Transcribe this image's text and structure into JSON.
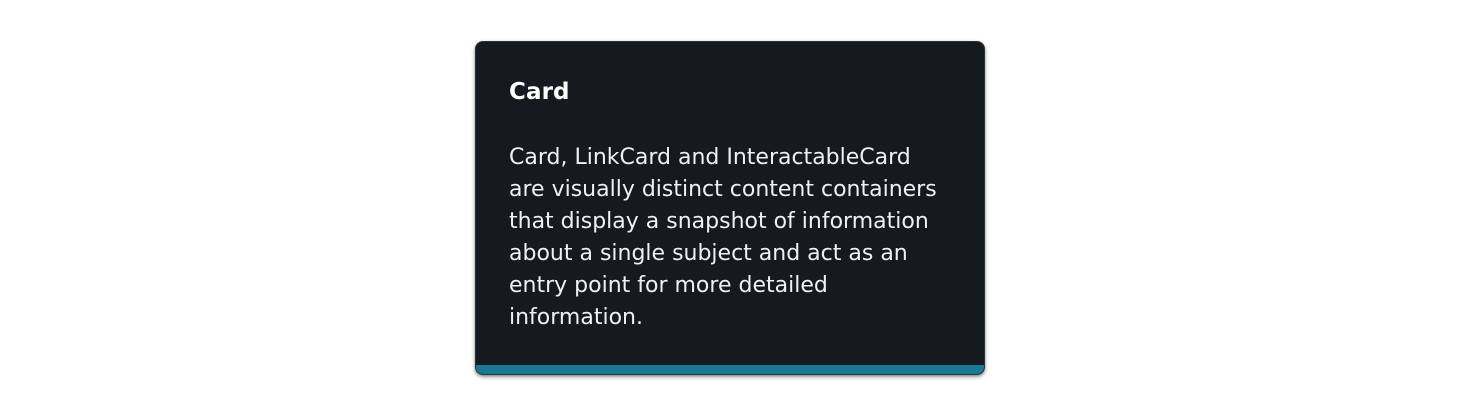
{
  "card": {
    "title": "Card",
    "description": "Card, LinkCard and InteractableCard are visually distinct content containers that display a snapshot of information about a single subject and act as an entry point for more detailed information.",
    "accent_color": "#1b7796",
    "background_color": "#141a20"
  }
}
